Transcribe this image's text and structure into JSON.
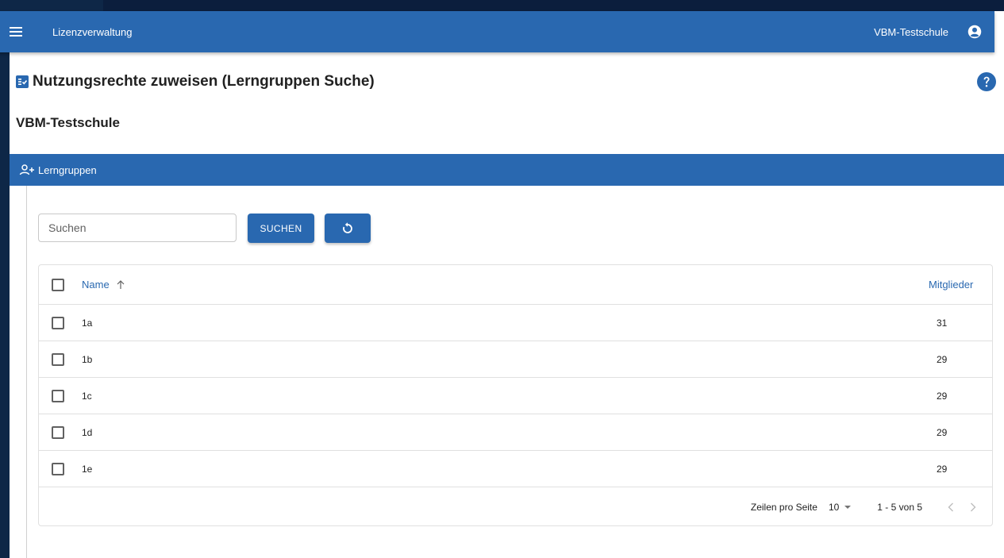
{
  "appbar": {
    "title": "Lizenzverwaltung",
    "school": "VBM-Testschule",
    "menu_icon": "menu-icon",
    "account_icon": "account-circle-icon"
  },
  "page": {
    "title": "Nutzungsrechte zuweisen (Lerngruppen Suche)",
    "title_icon": "assignment-check-icon",
    "help_icon": "help-circle-icon",
    "school_heading": "VBM-Testschule"
  },
  "section": {
    "label": "Lerngruppen",
    "icon": "person-add-icon"
  },
  "search": {
    "placeholder": "Suchen",
    "value": "",
    "button_label": "SUCHEN",
    "reset_icon": "refresh-icon"
  },
  "table": {
    "columns": {
      "name": "Name",
      "members": "Mitglieder"
    },
    "sort": {
      "column": "name",
      "direction": "ascending",
      "icon": "arrow-up-icon"
    },
    "rows": [
      {
        "name": "1a",
        "members": "31"
      },
      {
        "name": "1b",
        "members": "29"
      },
      {
        "name": "1c",
        "members": "29"
      },
      {
        "name": "1d",
        "members": "29"
      },
      {
        "name": "1e",
        "members": "29"
      }
    ]
  },
  "pagination": {
    "rows_per_page_label": "Zeilen pro Seite",
    "rows_per_page_value": "10",
    "range": "1 - 5 von 5"
  },
  "colors": {
    "primary": "#2968b0",
    "backdrop": "#0b1e3d"
  }
}
